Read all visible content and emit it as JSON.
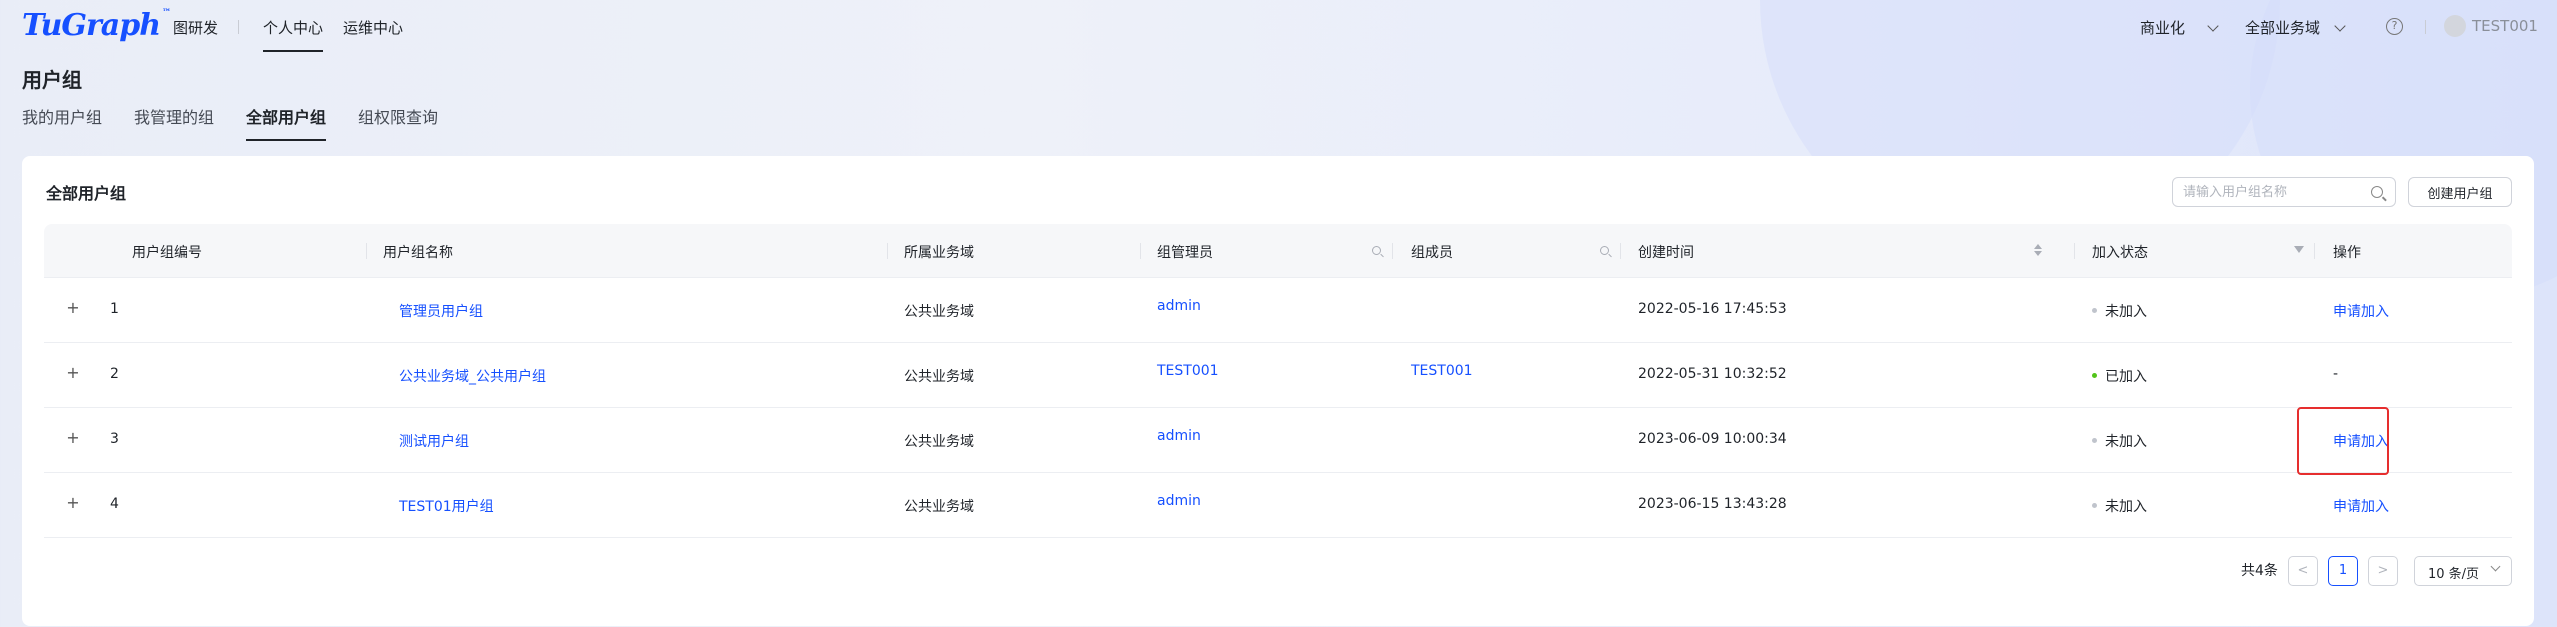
{
  "app": {
    "logo": "TuGraph",
    "logo_mark": "™",
    "nav": [
      "图研发",
      "个人中心",
      "运维中心"
    ],
    "commercial": "商业化",
    "domain_select": "全部业务域",
    "help": "?",
    "user": "TEST001"
  },
  "page": {
    "title": "用户组",
    "tabs": [
      "我的用户组",
      "我管理的组",
      "全部用户组",
      "组权限查询"
    ],
    "active_tab": "全部用户组"
  },
  "card": {
    "title": "全部用户组",
    "search_placeholder": "请输入用户组名称",
    "create_button": "创建用户组"
  },
  "table": {
    "columns": [
      "用户组编号",
      "用户组名称",
      "所属业务域",
      "组管理员",
      "组成员",
      "创建时间",
      "加入状态",
      "操作"
    ],
    "rows": [
      {
        "expand": "+",
        "id": "1",
        "name": "管理员用户组",
        "domain": "公共业务域",
        "admin": "admin",
        "members": "",
        "created": "2022-05-16 17:45:53",
        "status": "未加入",
        "action": "申请加入"
      },
      {
        "expand": "+",
        "id": "2",
        "name": "公共业务域_公共用户组",
        "domain": "公共业务域",
        "admin": "TEST001",
        "members": "TEST001",
        "created": "2022-05-31 10:32:52",
        "status": "已加入",
        "action": "-"
      },
      {
        "expand": "+",
        "id": "3",
        "name": "测试用户组",
        "domain": "公共业务域",
        "admin": "admin",
        "members": "",
        "created": "2023-06-09 10:00:34",
        "status": "未加入",
        "action": "申请加入"
      },
      {
        "expand": "+",
        "id": "4",
        "name": "TEST01用户组",
        "domain": "公共业务域",
        "admin": "admin",
        "members": "",
        "created": "2023-06-15 13:43:28",
        "status": "未加入",
        "action": "申请加入"
      }
    ]
  },
  "pagination": {
    "total": "共4条",
    "prev": "<",
    "current_page": "1",
    "next": ">",
    "page_size": "10 条/页"
  },
  "colors": {
    "accent": "#1650ff",
    "joined_dot": "#52c41a",
    "not_joined_dot": "#c0c4cc",
    "highlight_box": "#e62e2e"
  }
}
